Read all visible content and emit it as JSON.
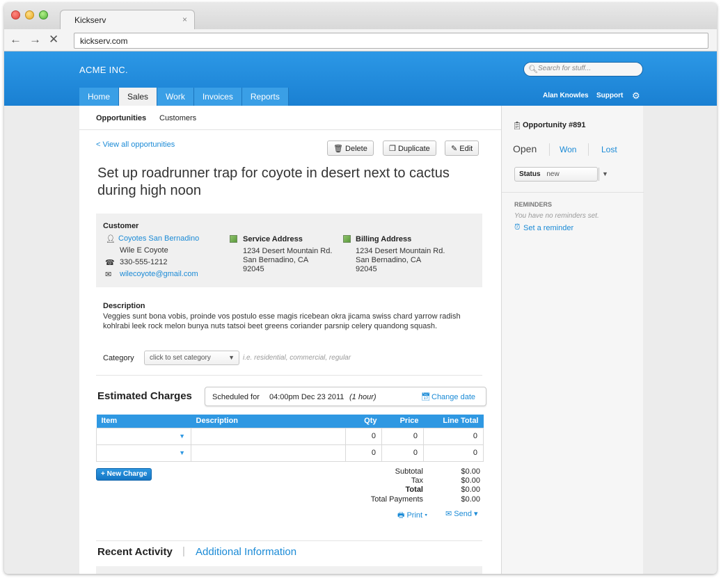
{
  "browser": {
    "tab_title": "Kickserv",
    "tab_close": "×",
    "url": "kickserv.com",
    "back": "←",
    "forward": "→",
    "stop": "✕"
  },
  "header": {
    "brand": "ACME INC.",
    "search_placeholder": "Search for stuff...",
    "tabs": [
      "Home",
      "Sales",
      "Work",
      "Invoices",
      "Reports"
    ],
    "active_tab": "Sales",
    "user": "Alan Knowles",
    "support": "Support",
    "accent_color": "#1a80d2"
  },
  "subnav": {
    "opportunities": "Opportunities",
    "customers": "Customers"
  },
  "actions": {
    "back_link": "< View all opportunities",
    "delete": "Delete",
    "duplicate": "Duplicate",
    "edit": "Edit"
  },
  "title": "Set up roadrunner trap for coyote in desert next to cactus during high noon",
  "customer": {
    "heading": "Customer",
    "company": "Coyotes San Bernadino",
    "contact": "Wile E Coyote",
    "phone": "330-555-1212",
    "email": "wilecoyote@gmail.com"
  },
  "service_address": {
    "heading": "Service Address",
    "line1": "1234 Desert Mountain Rd.",
    "line2": "San Bernadino, CA",
    "line3": "92045"
  },
  "billing_address": {
    "heading": "Billing Address",
    "line1": "1234 Desert Mountain Rd.",
    "line2": "San Bernadino, CA",
    "line3": "92045"
  },
  "description": {
    "heading": "Description",
    "text": "Veggies sunt bona vobis, proinde vos postulo esse magis ricebean okra jicama swiss chard yarrow radish kohlrabi leek rock melon bunya nuts tatsoi beet greens coriander parsnip celery quandong squash."
  },
  "category": {
    "label": "Category",
    "value": "click to set category",
    "hint": "i.e. residential, commercial, regular"
  },
  "charges": {
    "heading": "Estimated Charges",
    "scheduled_label": "Scheduled for",
    "scheduled_value": "04:00pm Dec 23 2011",
    "duration": "(1 hour)",
    "change_date": "Change date",
    "columns": [
      "Item",
      "Description",
      "Qty",
      "Price",
      "Line Total"
    ],
    "rows": [
      {
        "qty": "0",
        "price": "0",
        "total": "0"
      },
      {
        "qty": "0",
        "price": "0",
        "total": "0"
      }
    ],
    "new_charge": "+ New Charge",
    "totals": [
      {
        "label": "Subtotal",
        "value": "$0.00"
      },
      {
        "label": "Tax",
        "value": "$0.00"
      },
      {
        "label": "Total",
        "value": "$0.00"
      },
      {
        "label": "Total Payments",
        "value": "$0.00"
      }
    ],
    "print": "Print",
    "send": "Send"
  },
  "bottom_tabs": {
    "recent": "Recent Activity",
    "divider": "|",
    "additional": "Additional Information"
  },
  "sidebar": {
    "opportunity": "Opportunity #891",
    "open": "Open",
    "won": "Won",
    "lost": "Lost",
    "status_label": "Status",
    "status_value": "new",
    "reminders_heading": "REMINDERS",
    "no_reminders": "You have no reminders set.",
    "set_reminder": "Set a reminder"
  }
}
